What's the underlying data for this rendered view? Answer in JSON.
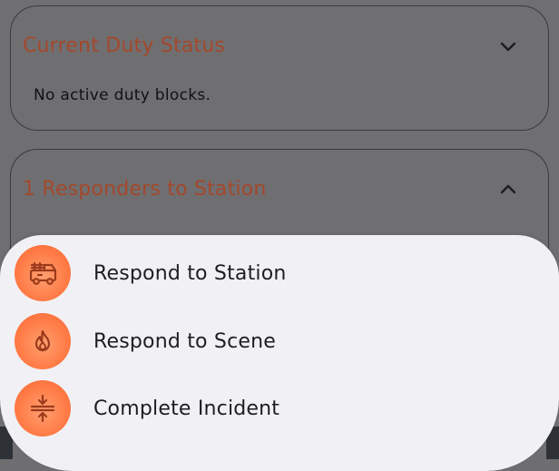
{
  "duty_status": {
    "title": "Current Duty Status",
    "body": "No active duty blocks.",
    "chevron": "chevron-down-icon"
  },
  "responders": {
    "title": "1 Responders to Station",
    "chevron": "chevron-up-icon"
  },
  "actions": [
    {
      "label": "Respond to Station",
      "icon": "fire-truck-icon"
    },
    {
      "label": "Respond to Scene",
      "icon": "flame-icon"
    },
    {
      "label": "Complete Incident",
      "icon": "compress-icon"
    }
  ],
  "colors": {
    "accent": "#a3482c",
    "icon_circle": "#ff7a45",
    "sheet": "#f1f1f5",
    "backdrop": "#6f6f71"
  }
}
